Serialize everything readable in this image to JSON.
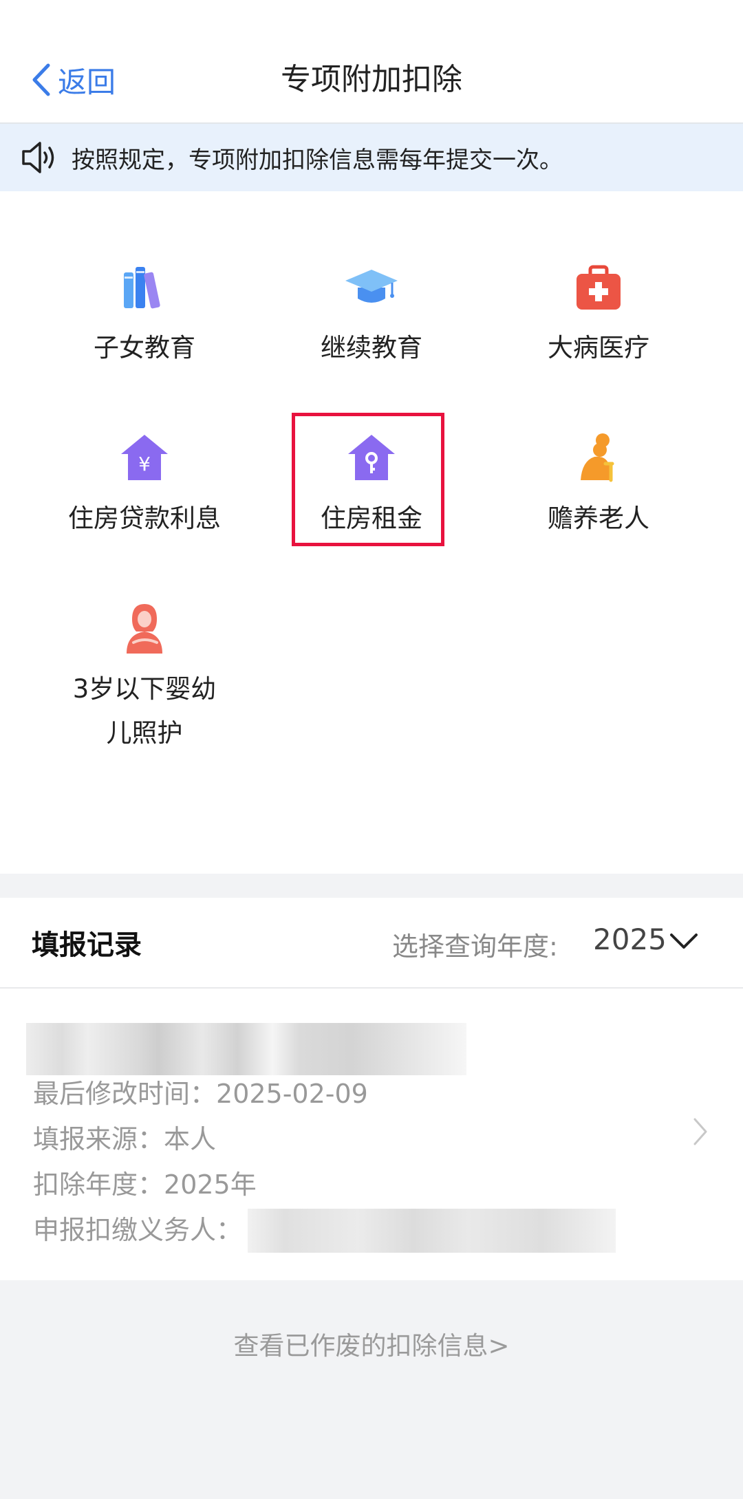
{
  "header": {
    "back_label": "返回",
    "title": "专项附加扣除"
  },
  "notice": {
    "text": "按照规定，专项附加扣除信息需每年提交一次。"
  },
  "categories": [
    {
      "label": "子女教育",
      "icon": "books-icon"
    },
    {
      "label": "继续教育",
      "icon": "graduation-cap-icon"
    },
    {
      "label": "大病医疗",
      "icon": "medical-kit-icon"
    },
    {
      "label": "住房贷款利息",
      "icon": "house-yuan-icon"
    },
    {
      "label": "住房租金",
      "icon": "house-key-icon",
      "highlighted": true
    },
    {
      "label": "赡养老人",
      "icon": "elderly-person-icon"
    },
    {
      "label": "3岁以下婴幼儿照护",
      "icon": "mother-baby-icon"
    }
  ],
  "records": {
    "title": "填报记录",
    "year_label": "选择查询年度:",
    "year_value": "2025",
    "card": {
      "modified_label": "最后修改时间：",
      "modified_value": "2025-02-09",
      "source_label": "填报来源：",
      "source_value": "本人",
      "deduct_year_label": "扣除年度：",
      "deduct_year_value": "2025年",
      "withholder_label": "申报扣缴义务人："
    }
  },
  "footer": {
    "void_link": "查看已作废的扣除信息>"
  },
  "colors": {
    "accent": "#3b7ce8",
    "highlight_border": "#e8123e",
    "notice_bg": "#e8f1fc"
  }
}
